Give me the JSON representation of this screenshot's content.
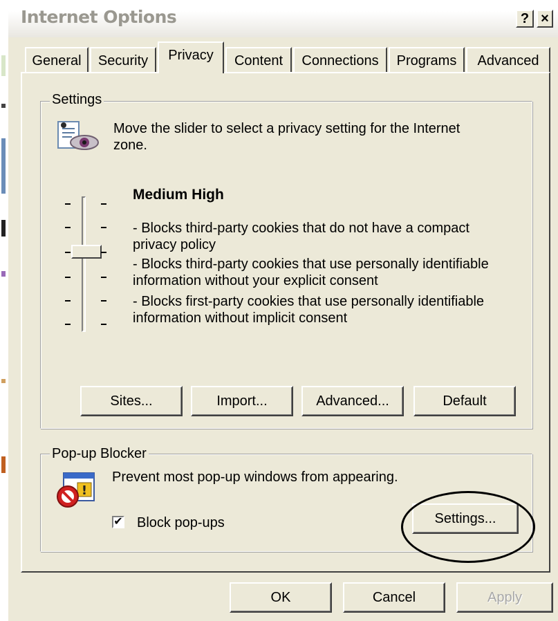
{
  "window": {
    "title": "Internet Options",
    "help_button": "?",
    "close_button": "×"
  },
  "tabs": [
    {
      "label": "General",
      "active": false
    },
    {
      "label": "Security",
      "active": false
    },
    {
      "label": "Privacy",
      "active": true
    },
    {
      "label": "Content",
      "active": false
    },
    {
      "label": "Connections",
      "active": false
    },
    {
      "label": "Programs",
      "active": false
    },
    {
      "label": "Advanced",
      "active": false
    }
  ],
  "settings_group": {
    "legend": "Settings",
    "intro_line1": "Move the slider to select a privacy setting for the Internet",
    "intro_line2": "zone.",
    "level_name": "Medium High",
    "level_position": "3 of 6",
    "desc_lines": [
      "- Blocks third-party cookies that do not have a compact",
      "privacy policy",
      "- Blocks third-party cookies that use personally identifiable",
      "information without your explicit consent",
      "- Blocks first-party cookies that use personally identifiable",
      "information without implicit consent"
    ],
    "buttons": {
      "sites": "Sites...",
      "import": "Import...",
      "advanced": "Advanced...",
      "default": "Default"
    }
  },
  "popup_group": {
    "legend": "Pop-up Blocker",
    "description": "Prevent most pop-up windows from appearing.",
    "checkbox_label": "Block pop-ups",
    "checkbox_checked": true,
    "checkbox_mark": "✔",
    "settings_button": "Settings..."
  },
  "footer": {
    "ok": "OK",
    "cancel": "Cancel",
    "apply": "Apply",
    "apply_enabled": false
  },
  "icons": {
    "privacy": "privacy-eye-icon",
    "popup": "popup-blocker-icon"
  },
  "colors": {
    "dialog_bg": "#ece9d8",
    "annotation": "#000000"
  }
}
